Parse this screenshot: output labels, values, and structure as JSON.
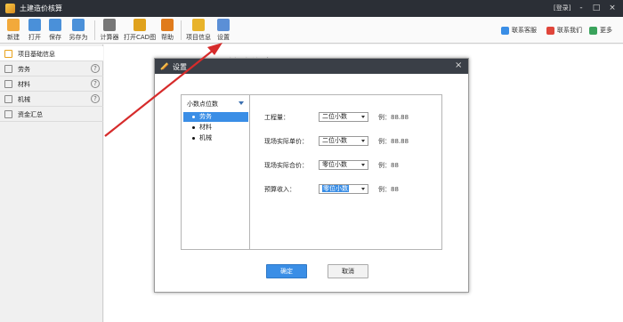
{
  "app": {
    "title": "土建造价核算",
    "login": "[登录]"
  },
  "window_controls": [
    "-",
    "□",
    "×"
  ],
  "toolbar": {
    "buttons": [
      {
        "label": "新建",
        "icon": "new-file-icon",
        "color": "#f2a93b"
      },
      {
        "label": "打开",
        "icon": "open-folder-icon",
        "color": "#4a90d9"
      },
      {
        "label": "保存",
        "icon": "save-icon",
        "color": "#4a90d9"
      },
      {
        "label": "另存为",
        "icon": "save-as-icon",
        "color": "#4a90d9"
      },
      {
        "label": "计算器",
        "icon": "calculator-icon",
        "color": "#777777"
      },
      {
        "label": "打开CAD图",
        "icon": "cad-icon",
        "color": "#e0a21c"
      },
      {
        "label": "帮助",
        "icon": "help-book-icon",
        "color": "#e07b1c"
      },
      {
        "label": "项目信息",
        "icon": "project-info-icon",
        "color": "#e8b32a"
      },
      {
        "label": "设置",
        "icon": "settings-icon",
        "color": "#5b8fd6"
      }
    ],
    "contacts": [
      {
        "label": "联系客服",
        "icon": "customer-service-icon",
        "color": "#3a8ee6"
      },
      {
        "label": "联系我们",
        "icon": "contact-us-icon",
        "color": "#e0453a"
      },
      {
        "label": "更多",
        "icon": "more-icon",
        "color": "#3aa35c"
      }
    ]
  },
  "sidebar": {
    "items": [
      {
        "label": "项目基础信息",
        "icon": "document-icon",
        "help": false,
        "active": true
      },
      {
        "label": "劳务",
        "icon": "labor-icon",
        "help": true,
        "active": false
      },
      {
        "label": "材料",
        "icon": "material-icon",
        "help": true,
        "active": false
      },
      {
        "label": "机械",
        "icon": "machinery-icon",
        "help": true,
        "active": false
      },
      {
        "label": "资金汇总",
        "icon": "funds-icon",
        "help": false,
        "active": false
      }
    ],
    "help_glyph": "?"
  },
  "background_heading": "项目基础信息",
  "dialog": {
    "title": "设置",
    "close": "×",
    "tree": {
      "header": "小数点位数",
      "items": [
        "劳务",
        "材料",
        "机械"
      ],
      "active_index": 0
    },
    "rows": [
      {
        "label": "工程量：",
        "value": "二位小数",
        "example": "例：88.88"
      },
      {
        "label": "现场实际单价：",
        "value": "二位小数",
        "example": "例：88.88"
      },
      {
        "label": "现场实际合价：",
        "value": "零位小数",
        "example": "例：88"
      },
      {
        "label": "预算收入：",
        "value": "零位小数",
        "example": "例：88"
      }
    ],
    "ok_label": "确定",
    "cancel_label": "取消"
  },
  "colors": {
    "accent": "#3a8ee6",
    "titlebar": "#2b2f36",
    "arrow": "#d62b2b"
  }
}
